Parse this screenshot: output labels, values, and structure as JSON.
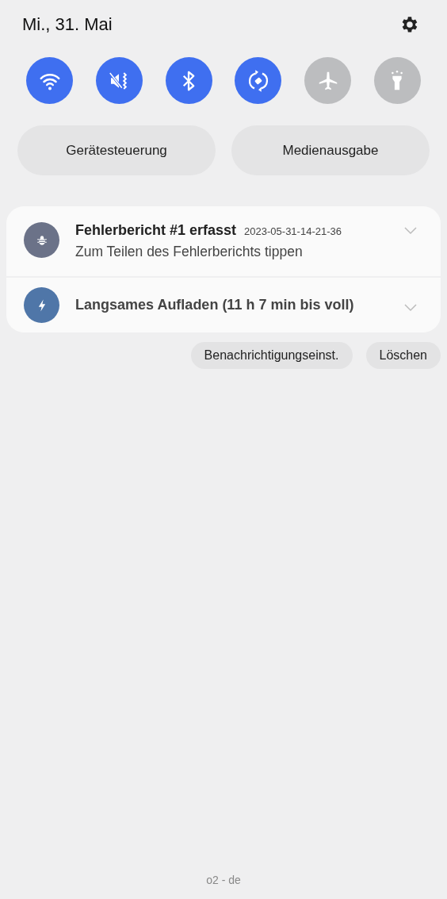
{
  "header": {
    "date": "Mi., 31. Mai"
  },
  "toggles": [
    {
      "kind": "wifi",
      "on": true
    },
    {
      "kind": "mute",
      "on": true
    },
    {
      "kind": "bluetooth",
      "on": true
    },
    {
      "kind": "rotate",
      "on": true
    },
    {
      "kind": "airplane",
      "on": false
    },
    {
      "kind": "flashlight",
      "on": false
    }
  ],
  "shortcuts": [
    "Gerätesteuerung",
    "Medienausgabe"
  ],
  "notifications": [
    {
      "kind": "bug",
      "color": "#6b7288",
      "title": "Fehlerbericht #1 erfasst",
      "time": "2023-05-31-14-21-36",
      "text": "Zum Teilen des Fehlerberichts tippen"
    },
    {
      "kind": "bolt",
      "color": "#4f76a8",
      "title": "Langsames Aufladen (11 h 7 min bis voll)"
    }
  ],
  "actions": [
    "Benachrichtigungseinst.",
    "Löschen"
  ],
  "carrier": "o2 - de"
}
